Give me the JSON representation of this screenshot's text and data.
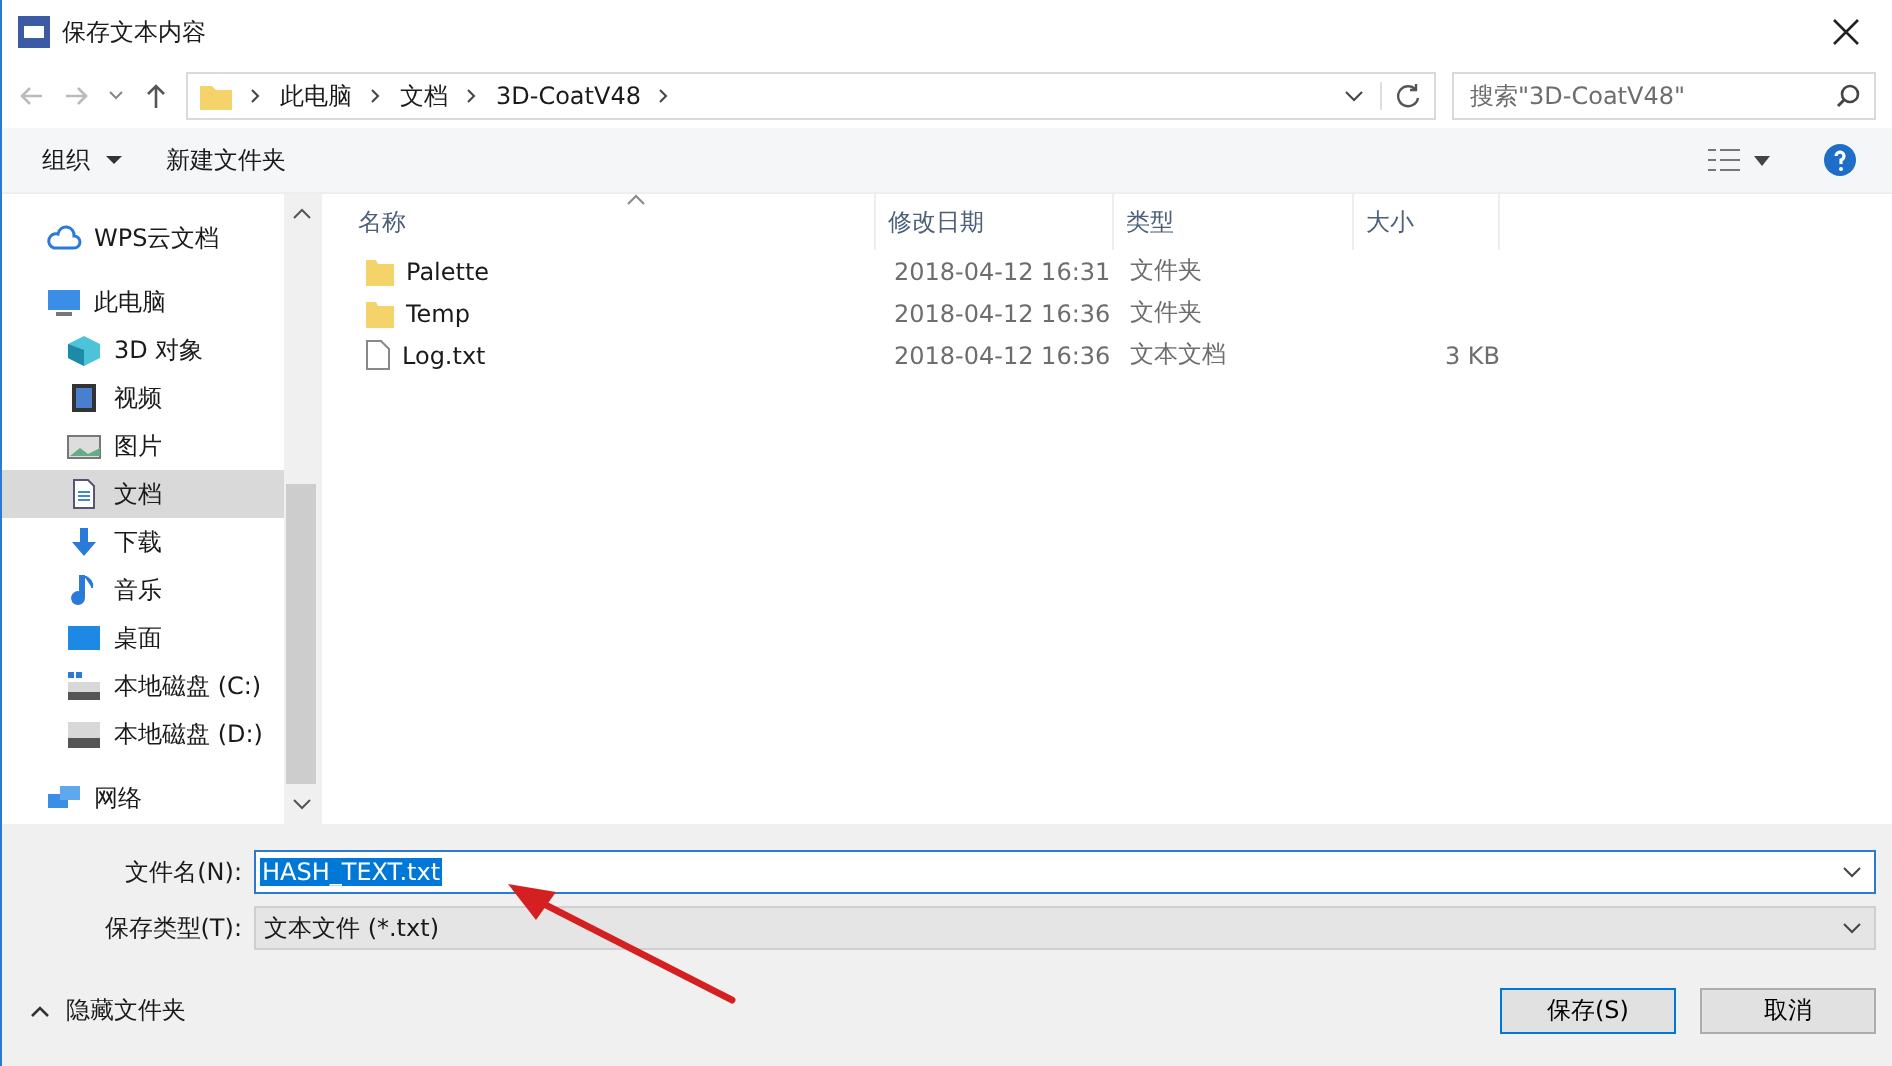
{
  "window": {
    "title": "保存文本内容"
  },
  "address": {
    "path": [
      "此电脑",
      "文档",
      "3D-CoatV48"
    ]
  },
  "search": {
    "placeholder": "搜索\"3D-CoatV48\""
  },
  "toolbar": {
    "organize": "组织",
    "new_folder": "新建文件夹"
  },
  "sidebar": {
    "items": [
      {
        "label": "WPS云文档",
        "kind": "cloud",
        "selected": false
      },
      {
        "label": "此电脑",
        "kind": "pc",
        "selected": false,
        "children": [
          {
            "label": "3D 对象",
            "kind": "cube",
            "selected": false
          },
          {
            "label": "视频",
            "kind": "video",
            "selected": false
          },
          {
            "label": "图片",
            "kind": "image",
            "selected": false
          },
          {
            "label": "文档",
            "kind": "doc",
            "selected": true
          },
          {
            "label": "下载",
            "kind": "download",
            "selected": false
          },
          {
            "label": "音乐",
            "kind": "music",
            "selected": false
          },
          {
            "label": "桌面",
            "kind": "desktop",
            "selected": false
          },
          {
            "label": "本地磁盘 (C:)",
            "kind": "systemdrive",
            "selected": false
          },
          {
            "label": "本地磁盘 (D:)",
            "kind": "drive",
            "selected": false
          }
        ]
      },
      {
        "label": "网络",
        "kind": "network",
        "selected": false
      }
    ]
  },
  "table": {
    "columns": [
      "名称",
      "修改日期",
      "类型",
      "大小"
    ],
    "rows": [
      {
        "kind": "folder",
        "name": "Palette",
        "date": "2018-04-12 16:31",
        "type": "文件夹"
      },
      {
        "kind": "folder",
        "name": "Temp",
        "date": "2018-04-12 16:36",
        "type": "文件夹"
      },
      {
        "kind": "file",
        "name": "Log.txt",
        "date": "2018-04-12 16:36",
        "type": "文本文档",
        "size": "3 KB"
      }
    ]
  },
  "filename": {
    "label": "文件名(N):",
    "value": "HASH_TEXT.txt"
  },
  "filetype": {
    "label": "保存类型(T):",
    "value": "文本文件 (*.txt)"
  },
  "hide_folders": "隐藏文件夹",
  "buttons": [
    {
      "label": "保存(S)",
      "kind": "primary"
    },
    {
      "label": "取消",
      "kind": "normal"
    }
  ]
}
